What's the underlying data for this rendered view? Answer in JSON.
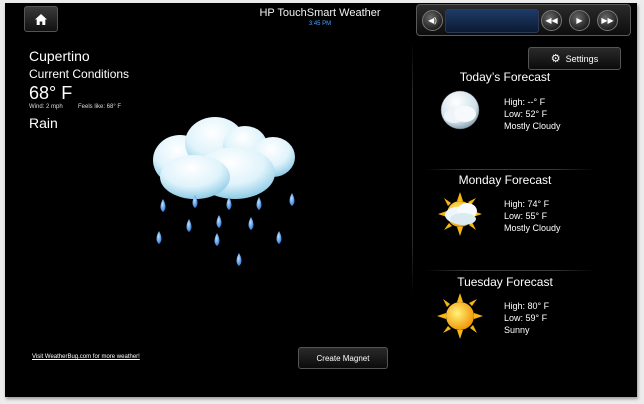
{
  "header": {
    "title": "HP TouchSmart Weather",
    "time": "3:45 PM"
  },
  "current": {
    "city": "Cupertino",
    "heading": "Current Conditions",
    "temperature": "68° F",
    "wind": "Wind: 2 mph",
    "feels_like": "Feels like: 68° F",
    "condition": "Rain",
    "icon": "rain-cloud-icon"
  },
  "footer": {
    "link_text": "Visit WeatherBug.com for more weather!",
    "magnet_button": "Create Magnet"
  },
  "settings_button": "Settings",
  "forecasts": [
    {
      "title": "Today’s Forecast",
      "high": "High: --° F",
      "low": "Low: 52° F",
      "condition": "Mostly Cloudy",
      "icon": "mostly-cloudy-icon"
    },
    {
      "title": "Monday Forecast",
      "high": "High: 74° F",
      "low": "Low: 55° F",
      "condition": "Mostly Cloudy",
      "icon": "partly-sunny-icon"
    },
    {
      "title": "Tuesday Forecast",
      "high": "High: 80° F",
      "low": "Low: 59° F",
      "condition": "Sunny",
      "icon": "sun-icon"
    }
  ],
  "colors": {
    "background": "#000000",
    "time_accent": "#4aa3ff",
    "raindrop": "#3b8fe8"
  }
}
